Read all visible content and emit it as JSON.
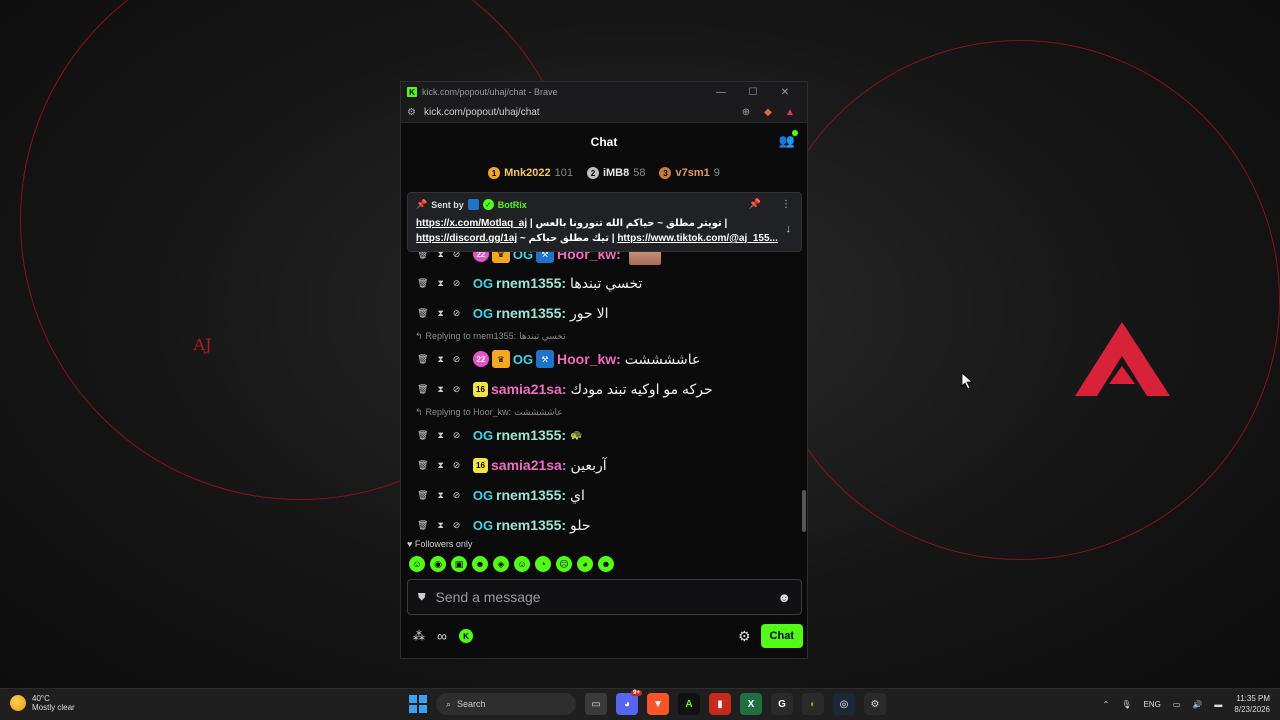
{
  "browser": {
    "window_title": "kick.com/popout/uhaj/chat - Brave",
    "url": "kick.com/popout/uhaj/chat"
  },
  "chat": {
    "header_title": "Chat",
    "leaderboard": [
      {
        "rank": "1",
        "name": "Mnk2022",
        "count": "101",
        "color": "#f5a623"
      },
      {
        "rank": "2",
        "name": "iMB8",
        "count": "58",
        "color": "#c0c0c0"
      },
      {
        "rank": "3",
        "name": "v7sm1",
        "count": "9",
        "color": "#c97a3a"
      }
    ],
    "pinned": {
      "sent_by_label": "Sent by",
      "sender": "BotRix",
      "line1_link": "https://x.com/Motlaq_aj",
      "line1_text": " | تويتر مطلق ~ حياكم الله تنورونا بالعس |",
      "line2_link": "https://discord.gg/1aj",
      "line2_text": " ~ تيك مطلق حياكم | ",
      "line2_link2": "https://www.tiktok.com/@aj_155..."
    },
    "messages": {
      "m0_user": "Hoor_kw:",
      "m1_user": "rnem1355:",
      "m1_text": "تخسي تبندها",
      "m2_user": "rnem1355:",
      "m2_text": "الا حور",
      "r3_text": "Replying to rnem1355:",
      "r3_quote": "تخسي تبندها",
      "m3_user": "Hoor_kw:",
      "m3_text": "عاششششت",
      "m4_user": "samia21sa:",
      "m4_text": "حركه مو اوكيه تبند مودك",
      "r5_text": "Replying to Hoor_kw:",
      "r5_quote": "عاششششت",
      "m5_user": "rnem1355:",
      "m5_text": "🐢",
      "m6_user": "samia21sa:",
      "m6_text": "آربعين",
      "m7_user": "rnem1355:",
      "m7_text": "اي",
      "m8_user": "rnem1355:",
      "m8_text": "حلو"
    },
    "badges": {
      "sub": "22",
      "age": "16",
      "og": "OG"
    },
    "followers_only": "Followers only",
    "input_placeholder": "Send a message",
    "infinity": "∞",
    "send_button": "Chat"
  },
  "wallpaper": {
    "aj_text": "AJ"
  },
  "taskbar": {
    "temperature": "40°C",
    "weather": "Mostly clear",
    "search_label": "Search",
    "discord_badge": "9+",
    "lang": "ENG",
    "time": "11:35 PM",
    "date": "8/23/2026"
  },
  "colors": {
    "kick_green": "#53fc18",
    "accent_red": "#b01a2a"
  }
}
